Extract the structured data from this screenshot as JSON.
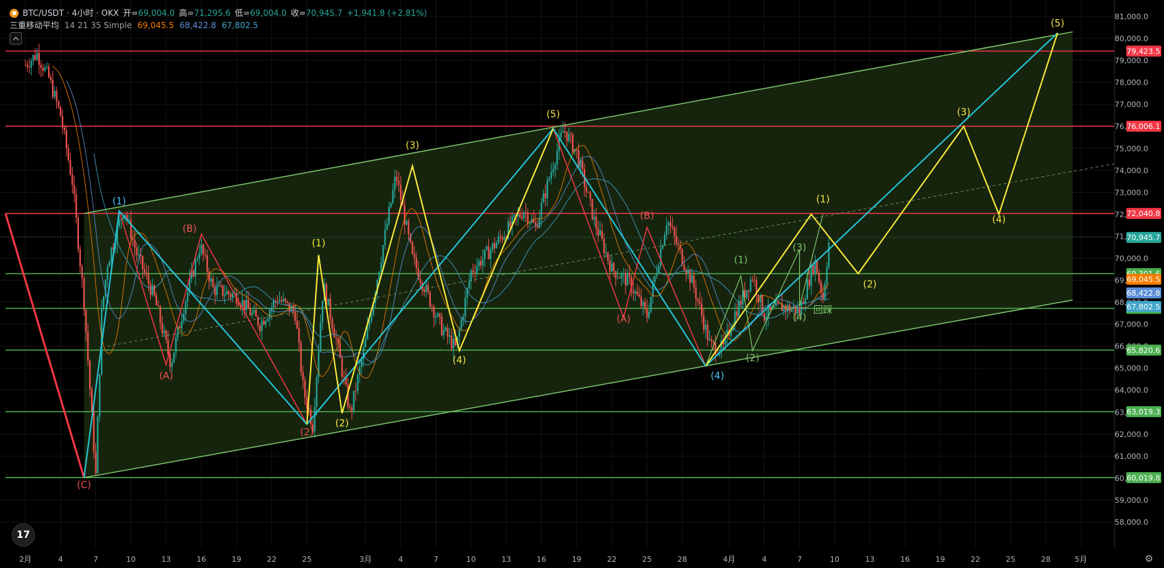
{
  "header": {
    "symbol": "BTC/USDT · 4小时 · OKX",
    "open_label": "开=",
    "open": "69,004.0",
    "high_label": "高=",
    "high": "71,295.6",
    "low_label": "低=",
    "low": "69,004.0",
    "close_label": "收=",
    "close": "70,945.7",
    "change": "+1,941.8 (+2.81%)",
    "ma_label": "三重移动平均",
    "ma_params": "14 21 35 Simple",
    "ma1": "69,045.5",
    "ma2": "68,422.8",
    "ma3": "67,802.5"
  },
  "logo_text": "17",
  "colors": {
    "background": "#000000",
    "up": "#26a69a",
    "down": "#ef5350",
    "ma1": "#f57c00",
    "ma2": "#5c8fd6",
    "ma3": "#42a5c9",
    "red_level": "#f23645",
    "green_level": "#4caf50",
    "channel_fill": "#1a2a10",
    "wave_yellow": "#ffeb3b",
    "wave_cyan": "#26c6da",
    "wave_red": "#f23645"
  },
  "chart_data": {
    "type": "candlestick",
    "symbol": "BTC/USDT",
    "timeframe": "4小时",
    "exchange": "OKX",
    "x_tick_labels": [
      "2月",
      "4",
      "7",
      "10",
      "13",
      "16",
      "19",
      "22",
      "25",
      "3月",
      "4",
      "7",
      "10",
      "13",
      "16",
      "19",
      "22",
      "25",
      "28",
      "4月",
      "4",
      "7",
      "10",
      "13",
      "16",
      "19",
      "22",
      "25",
      "28",
      "5月"
    ],
    "y_tick_labels": [
      "58,000.0",
      "59,000.0",
      "60,000.0",
      "61,000.0",
      "62,000.0",
      "63,000.0",
      "64,000.0",
      "65,000.0",
      "66,000.0",
      "67,000.0",
      "68,000.0",
      "69,000.0",
      "70,000.0",
      "71,000.0",
      "72,000.0",
      "73,000.0",
      "74,000.0",
      "75,000.0",
      "76,000.0",
      "77,000.0",
      "78,000.0",
      "79,000.0",
      "80,000.0",
      "81,000.0"
    ],
    "ylim": [
      57300,
      81400
    ],
    "horizontal_levels": [
      {
        "value": 79423.5,
        "label": "79,423.5",
        "color": "red"
      },
      {
        "value": 76006.1,
        "label": "76,006.1",
        "color": "red"
      },
      {
        "value": 72040.8,
        "label": "72,040.8",
        "color": "red"
      },
      {
        "value": 69301.6,
        "label": "69,301.6",
        "color": "green"
      },
      {
        "value": 67721.6,
        "label": "67,721.6",
        "color": "green"
      },
      {
        "value": 65820.6,
        "label": "65,820.6",
        "color": "green"
      },
      {
        "value": 63019.3,
        "label": "63,019.3",
        "color": "green"
      },
      {
        "value": 60019.8,
        "label": "60,019.8",
        "color": "green"
      }
    ],
    "price_tags": [
      {
        "value": 70945.7,
        "label": "70,945.7",
        "color": "up"
      },
      {
        "value": 69045.5,
        "label": "69,045.5",
        "color": "ma1"
      },
      {
        "value": 68422.8,
        "label": "68,422.8",
        "color": "ma2"
      },
      {
        "value": 67802.5,
        "label": "67,802.5",
        "color": "ma3"
      }
    ],
    "wave_labels": [
      {
        "text": "(1)",
        "color": "cyan",
        "date": "2月9",
        "price": 72450
      },
      {
        "text": "(B)",
        "color": "red",
        "date": "2月15",
        "price": 71200
      },
      {
        "text": "(A)",
        "color": "red",
        "date": "2月13",
        "price": 64500
      },
      {
        "text": "(C)",
        "color": "red",
        "date": "2月6",
        "price": 59550
      },
      {
        "text": "(2)",
        "color": "red",
        "date": "2月25",
        "price": 61950
      },
      {
        "text": "(1)",
        "color": "yellow",
        "date": "2月26",
        "price": 70550
      },
      {
        "text": "(2)",
        "color": "yellow",
        "date": "2月28",
        "price": 62350
      },
      {
        "text": "(3)",
        "color": "yellow",
        "date": "3月5",
        "price": 75000
      },
      {
        "text": "(4)",
        "color": "yellow",
        "date": "3月9",
        "price": 65230
      },
      {
        "text": "(5)",
        "color": "yellow",
        "date": "3月17",
        "price": 76420
      },
      {
        "text": "(B)",
        "color": "red",
        "date": "3月25",
        "price": 71800
      },
      {
        "text": "(A)",
        "color": "red",
        "date": "3月23",
        "price": 67100
      },
      {
        "text": "(4)",
        "color": "cyan",
        "date": "3月31",
        "price": 64500
      },
      {
        "text": "(1)",
        "color": "green",
        "date": "4月2",
        "price": 69780
      },
      {
        "text": "(2)",
        "color": "green",
        "date": "4月3",
        "price": 65320
      },
      {
        "text": "(3)",
        "color": "green",
        "date": "4月7",
        "price": 70340
      },
      {
        "text": "(4)",
        "color": "green",
        "date": "4月7",
        "price": 67180
      },
      {
        "text": "回踩",
        "color": "green",
        "date": "4月9",
        "price": 67500
      },
      {
        "text": "(1)",
        "color": "yellow",
        "date": "4月9",
        "price": 72550
      },
      {
        "text": "(2)",
        "color": "yellow",
        "date": "4月13",
        "price": 68670
      },
      {
        "text": "(3)",
        "color": "yellow",
        "date": "4月21",
        "price": 76500
      },
      {
        "text": "(4)",
        "color": "yellow",
        "date": "4月24",
        "price": 71620
      },
      {
        "text": "(5)",
        "color": "yellow",
        "date": "4月29",
        "price": 80550
      }
    ],
    "ascending_channel": {
      "upper": [
        {
          "date": "2月6",
          "price": 72040
        },
        {
          "date": "4月29",
          "price": 80300
        }
      ],
      "lower": [
        {
          "date": "2月6",
          "price": 60020
        },
        {
          "date": "4月29",
          "price": 68100
        }
      ]
    }
  }
}
